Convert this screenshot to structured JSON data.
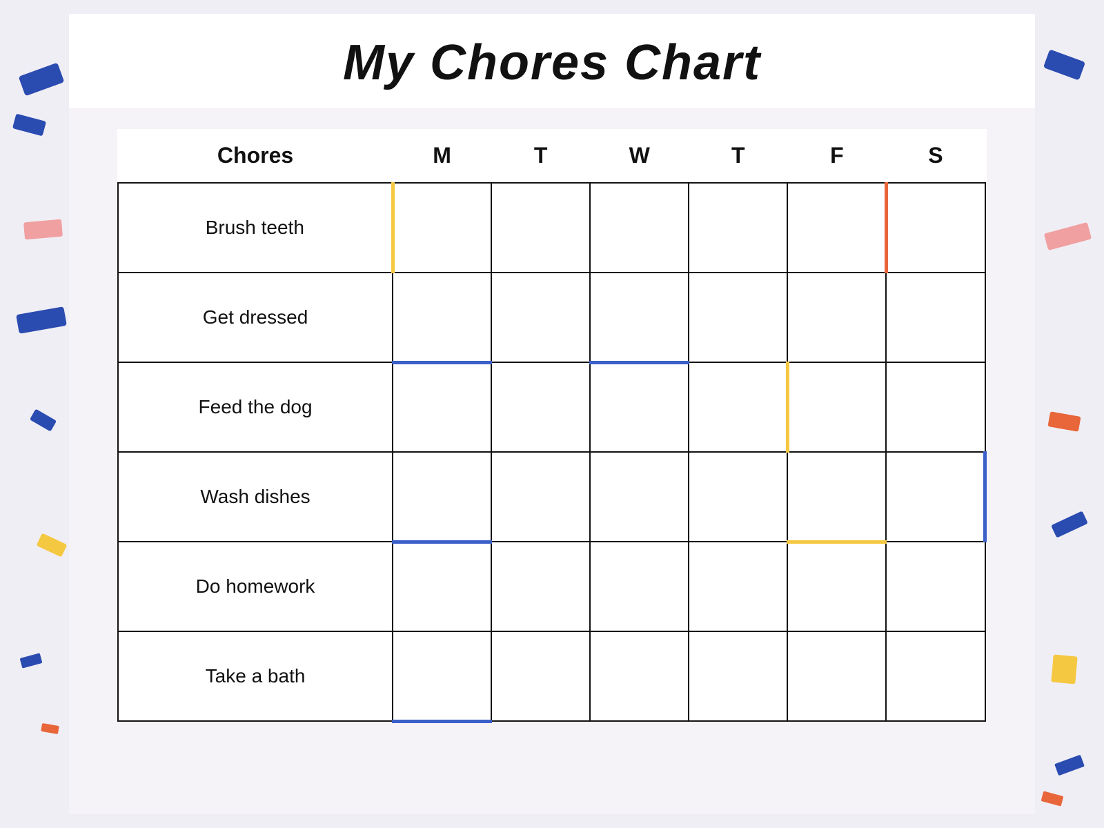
{
  "page": {
    "title": "My Chores Chart",
    "background_color": "#f0eef5"
  },
  "table": {
    "headers": {
      "chores": "Chores",
      "days": [
        "M",
        "T",
        "W",
        "T",
        "F",
        "S"
      ]
    },
    "rows": [
      {
        "id": "brush-teeth",
        "label": "Brush teeth"
      },
      {
        "id": "get-dressed",
        "label": "Get dressed"
      },
      {
        "id": "feed-the-dog",
        "label": "Feed the dog"
      },
      {
        "id": "wash-dishes",
        "label": "Wash dishes"
      },
      {
        "id": "do-homework",
        "label": "Do homework"
      },
      {
        "id": "take-a-bath",
        "label": "Take a bath"
      }
    ]
  },
  "decorations": {
    "colors": {
      "blue": "#2a4bb0",
      "orange": "#e8663a",
      "pink": "#f0a0a0",
      "yellow": "#f5c842"
    }
  }
}
